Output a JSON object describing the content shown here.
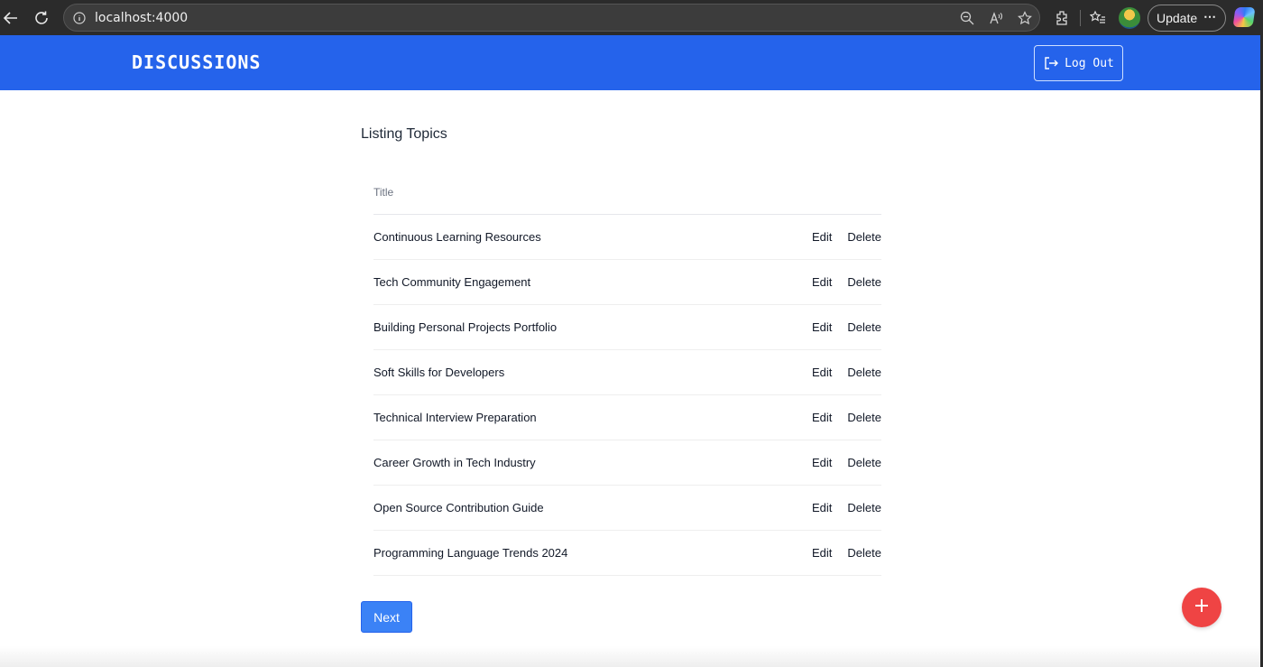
{
  "browser": {
    "url": "localhost:4000",
    "update_label": "Update",
    "more_label": "⋯"
  },
  "header": {
    "title": "DISCUSSIONS",
    "logout_label": "Log Out",
    "accent": "#2563eb"
  },
  "main": {
    "heading": "Listing Topics",
    "column_title": "Title",
    "topics": [
      {
        "title": "Continuous Learning Resources",
        "edit": "Edit",
        "delete": "Delete"
      },
      {
        "title": "Tech Community Engagement",
        "edit": "Edit",
        "delete": "Delete"
      },
      {
        "title": "Building Personal Projects Portfolio",
        "edit": "Edit",
        "delete": "Delete"
      },
      {
        "title": "Soft Skills for Developers",
        "edit": "Edit",
        "delete": "Delete"
      },
      {
        "title": "Technical Interview Preparation",
        "edit": "Edit",
        "delete": "Delete"
      },
      {
        "title": "Career Growth in Tech Industry",
        "edit": "Edit",
        "delete": "Delete"
      },
      {
        "title": "Open Source Contribution Guide",
        "edit": "Edit",
        "delete": "Delete"
      },
      {
        "title": "Programming Language Trends 2024",
        "edit": "Edit",
        "delete": "Delete"
      }
    ],
    "next_label": "Next"
  },
  "fab": {
    "icon": "plus-icon",
    "color": "#ef4444"
  }
}
